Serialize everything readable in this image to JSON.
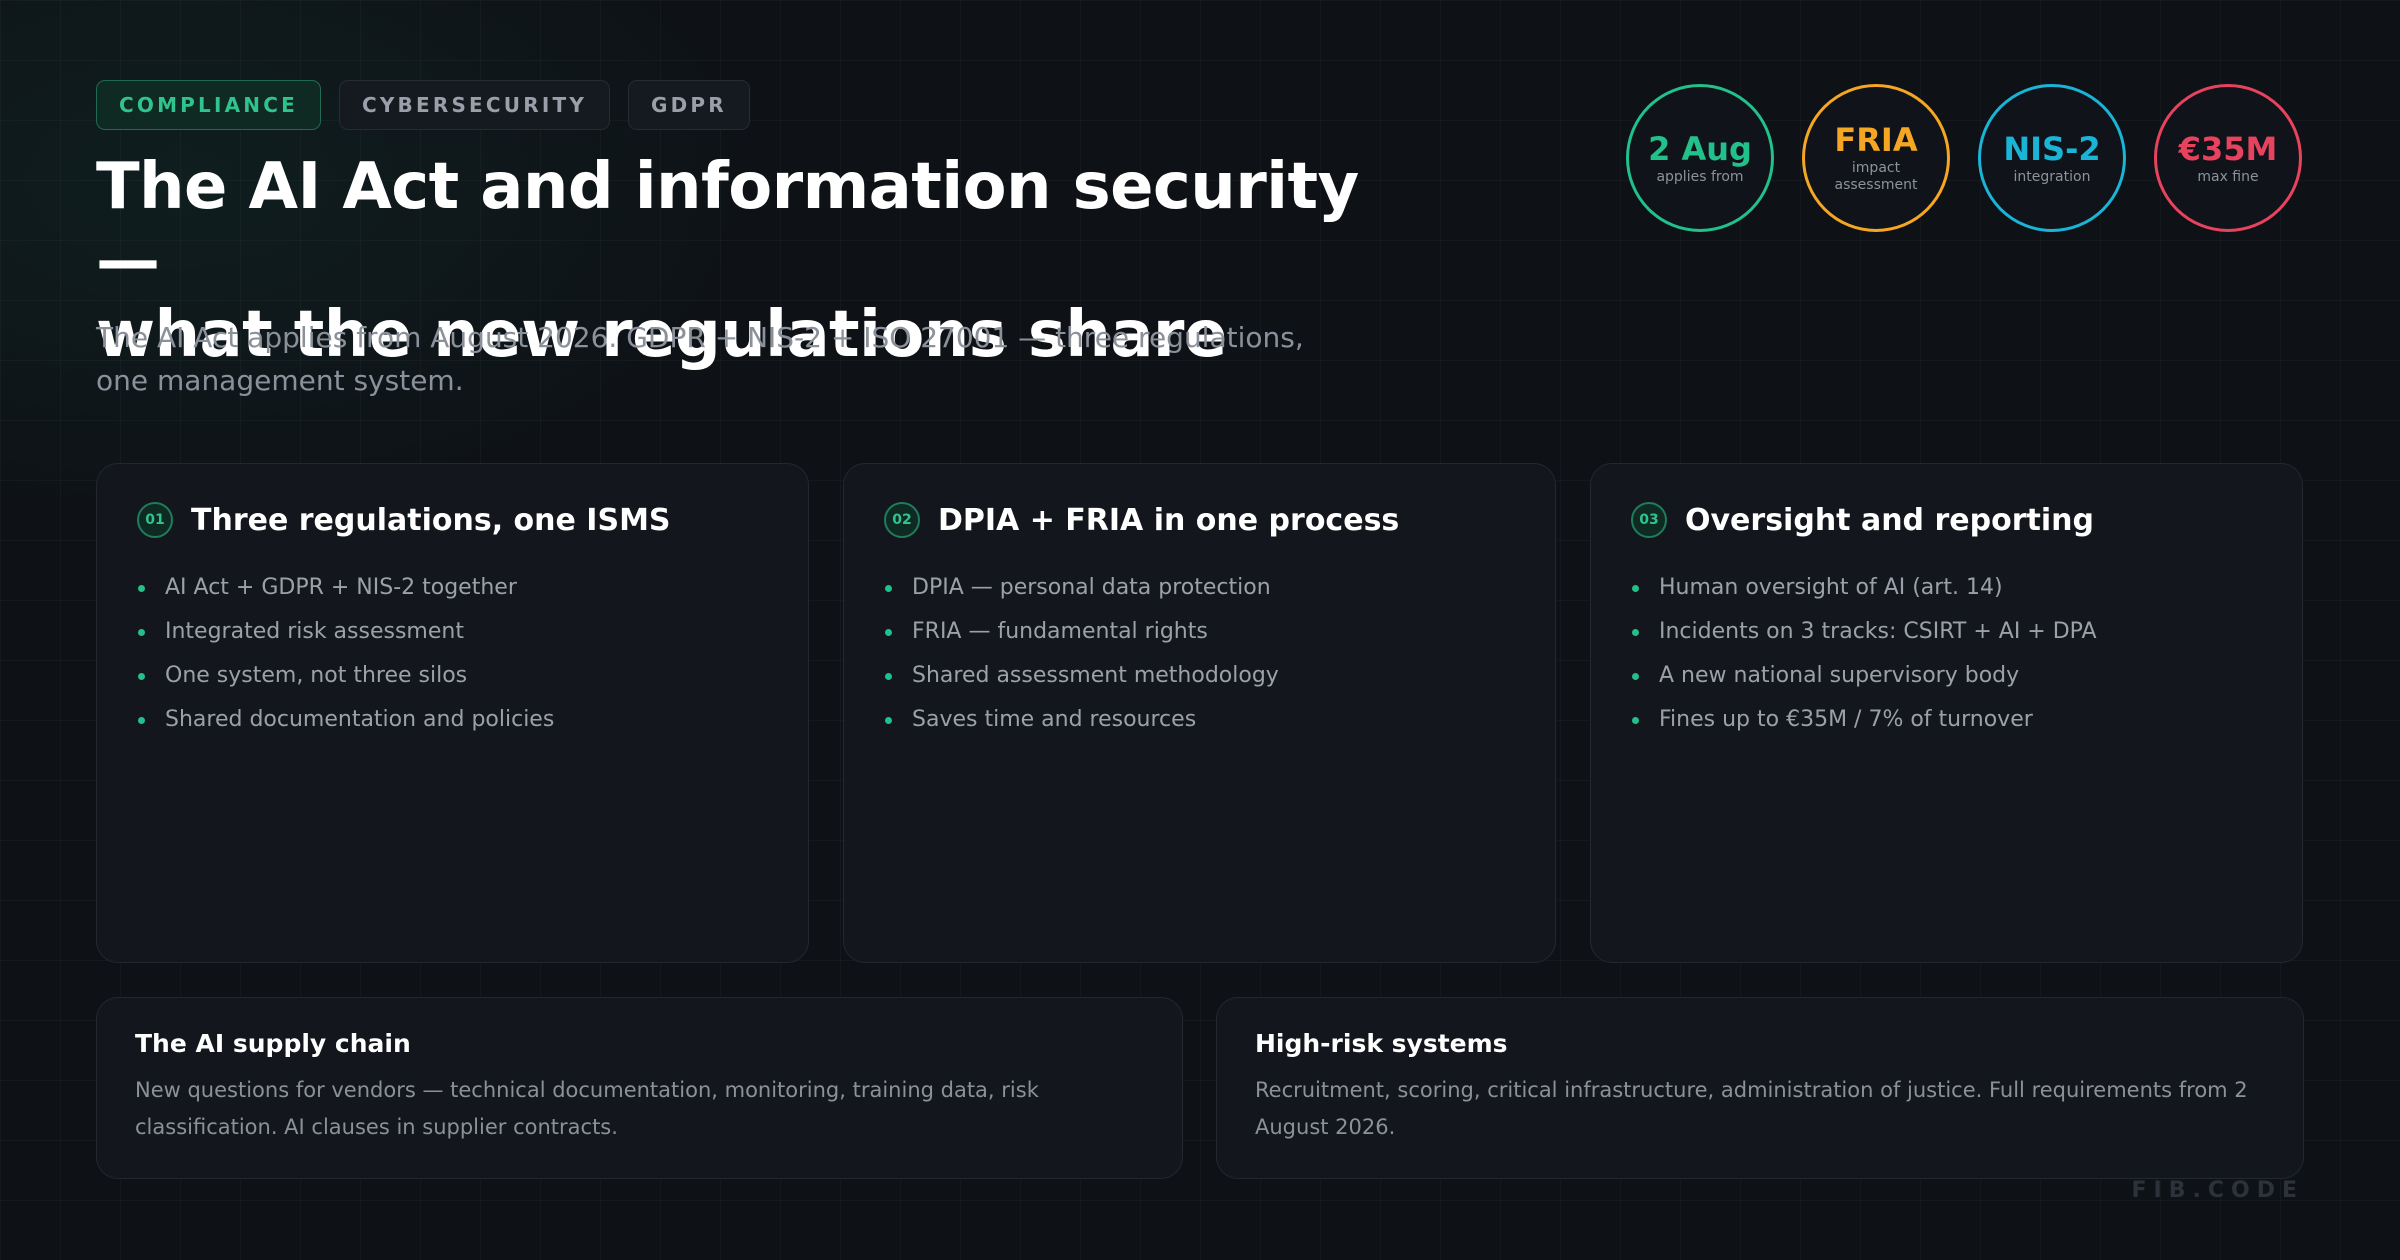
{
  "tags": [
    "COMPLIANCE",
    "CYBERSECURITY",
    "GDPR"
  ],
  "title_line1": "The AI Act and information security —",
  "title_line2": "what the new regulations share",
  "subtitle": "The AI Act applies from August 2026. GDPR + NIS-2 + ISO 27001 — three regulations, one management system.",
  "stats": [
    {
      "value": "2 Aug",
      "label": "applies from",
      "color": "#22c08a"
    },
    {
      "value": "FRIA",
      "label": "impact assessment",
      "color": "#f5a623"
    },
    {
      "value": "NIS-2",
      "label": "integration",
      "color": "#1ab4d6"
    },
    {
      "value": "€35M",
      "label": "max fine",
      "color": "#e8435e"
    }
  ],
  "cards": [
    {
      "number": "01",
      "title": "Three regulations, one ISMS",
      "items": [
        "AI Act + GDPR + NIS-2 together",
        "Integrated risk assessment",
        "One system, not three silos",
        "Shared documentation and policies"
      ]
    },
    {
      "number": "02",
      "title": "DPIA + FRIA in one process",
      "items": [
        "DPIA — personal data protection",
        "FRIA — fundamental rights",
        "Shared assessment methodology",
        "Saves time and resources"
      ]
    },
    {
      "number": "03",
      "title": "Oversight and reporting",
      "items": [
        "Human oversight of AI (art. 14)",
        "Incidents on 3 tracks: CSIRT + AI + DPA",
        "A new national supervisory body",
        "Fines up to €35M / 7% of turnover"
      ]
    }
  ],
  "bottom": [
    {
      "title": "The AI supply chain",
      "text": "New questions for vendors — technical documentation, monitoring, training data, risk classification. AI clauses in supplier contracts."
    },
    {
      "title": "High-risk systems",
      "text": "Recruitment, scoring, critical infrastructure, administration of justice. Full requirements from 2 August 2026."
    }
  ],
  "brand": "FIB.CODE"
}
